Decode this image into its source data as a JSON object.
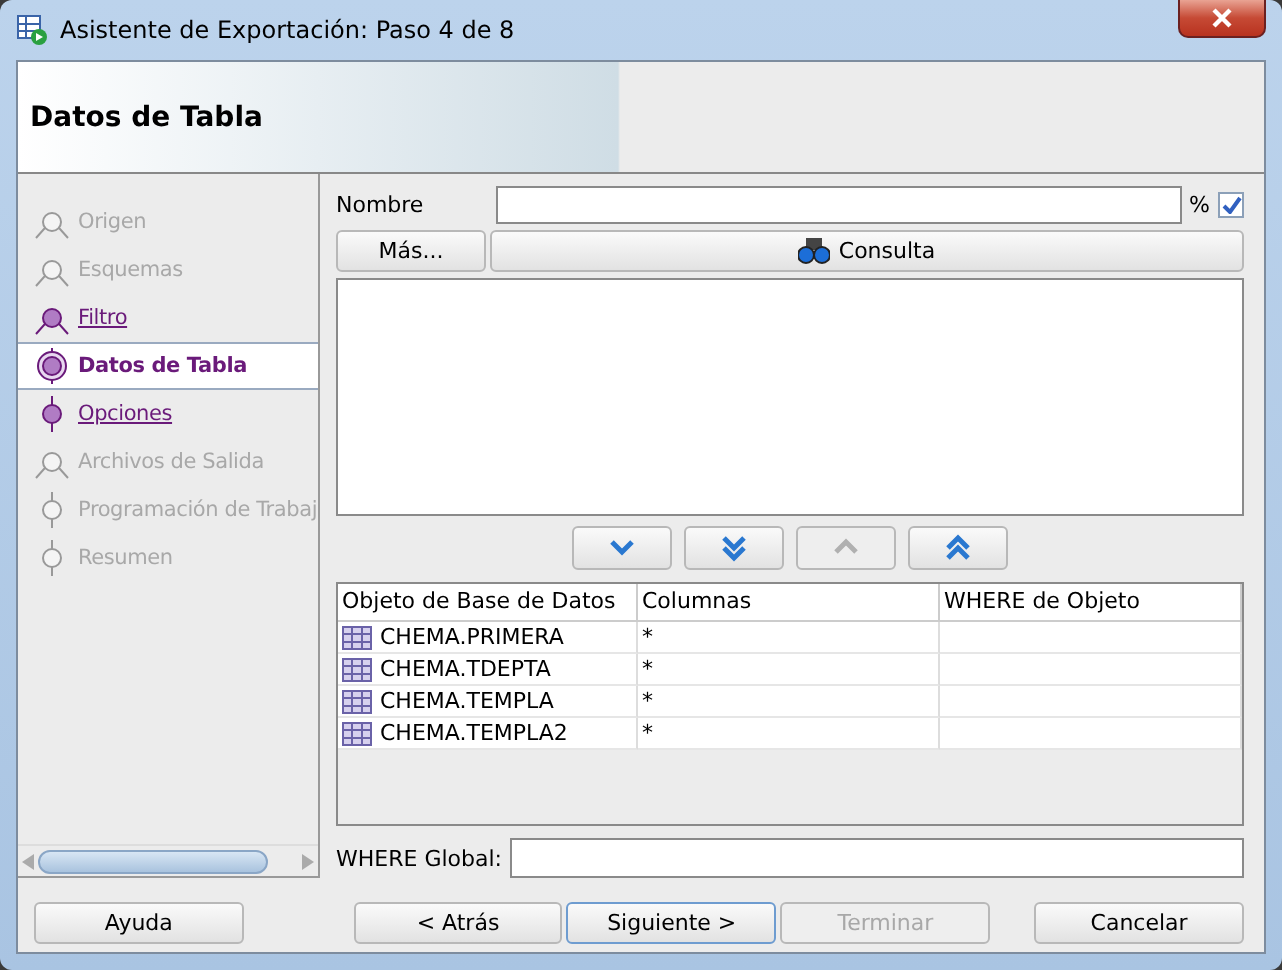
{
  "window": {
    "title": "Asistente de Exportación: Paso 4 de 8"
  },
  "header": {
    "title": "Datos de Tabla"
  },
  "steps": [
    {
      "label": "Origen",
      "visited": false,
      "selected": false,
      "branch": true
    },
    {
      "label": "Esquemas",
      "visited": false,
      "selected": false,
      "branch": true
    },
    {
      "label": "Filtro",
      "visited": true,
      "selected": false,
      "branch": true
    },
    {
      "label": "Datos de Tabla",
      "visited": true,
      "selected": true,
      "branch": false
    },
    {
      "label": "Opciones",
      "visited": true,
      "selected": false,
      "branch": false
    },
    {
      "label": "Archivos de Salida",
      "visited": false,
      "selected": false,
      "branch": true
    },
    {
      "label": "Programación de Trabaj",
      "visited": false,
      "selected": false,
      "branch": false
    },
    {
      "label": "Resumen",
      "visited": false,
      "selected": false,
      "branch": false
    }
  ],
  "name_field": {
    "label": "Nombre",
    "suffix": "%",
    "checked": true
  },
  "more_button": "Más...",
  "query_button": "Consulta",
  "move_buttons": [
    {
      "kind": "down",
      "disabled": false
    },
    {
      "kind": "all-down",
      "disabled": false
    },
    {
      "kind": "up",
      "disabled": true
    },
    {
      "kind": "all-up",
      "disabled": false
    }
  ],
  "table": {
    "columns": [
      "Objeto de Base de Datos",
      "Columnas",
      "WHERE de Objeto"
    ],
    "rows": [
      {
        "object": "CHEMA.PRIMERA",
        "columns": "*"
      },
      {
        "object": "CHEMA.TDEPTA",
        "columns": "*"
      },
      {
        "object": "CHEMA.TEMPLA",
        "columns": "*"
      },
      {
        "object": "CHEMA.TEMPLA2",
        "columns": "*"
      }
    ]
  },
  "where_global": {
    "label": "WHERE Global:"
  },
  "help_button": "Ayuda",
  "nav_buttons": [
    {
      "label": "< Atrás",
      "default": false,
      "disabled": false
    },
    {
      "label": "Siguiente >",
      "default": true,
      "disabled": false
    },
    {
      "label": "Terminar",
      "default": false,
      "disabled": true
    },
    {
      "label": "Cancelar",
      "default": false,
      "disabled": false
    }
  ]
}
